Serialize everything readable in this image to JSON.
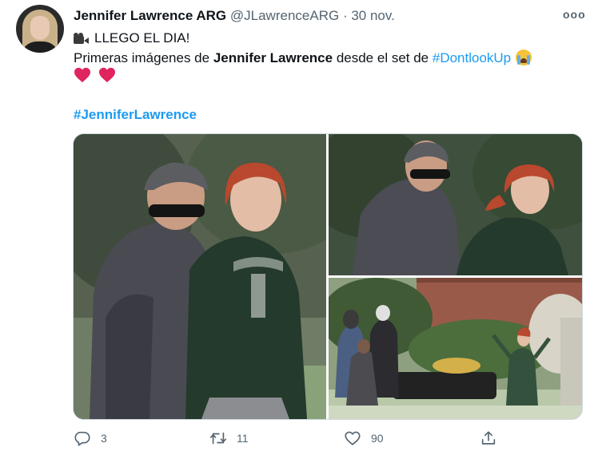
{
  "tweet": {
    "author_name": "Jennifer Lawrence ARG",
    "handle": "@JLawrenceARG",
    "separator": "·",
    "date": "30 nov.",
    "more_label": "ooo",
    "line1_text": "LLEGO EL DIA!",
    "line2_prefix": "Primeras imágenes de ",
    "line2_bold": "Jennifer Lawrence",
    "line2_mid": " desde el set de ",
    "line2_hashtag": "#DontlookUp",
    "hashtag_line": "#JenniferLawrence"
  },
  "actions": {
    "reply_count": "3",
    "retweet_count": "11",
    "like_count": "90"
  },
  "colors": {
    "link": "#1d9bf0",
    "muted": "#536471",
    "heart": "#e0245e"
  },
  "icons": [
    "movie-camera-icon",
    "crying-face-icon",
    "heart-emoji-icon",
    "reply-icon",
    "retweet-icon",
    "like-icon",
    "share-icon",
    "more-options-icon"
  ]
}
